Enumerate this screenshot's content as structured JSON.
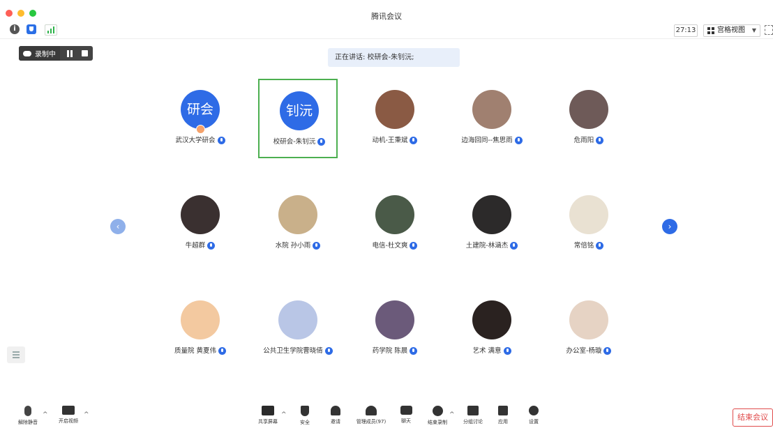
{
  "window": {
    "title": "腾讯会议"
  },
  "topbar": {
    "timer": "27:13",
    "view_mode": "宫格视图"
  },
  "recording": {
    "status": "录制中"
  },
  "speaking_banner": "正在讲话: 校研会-朱钊沅;",
  "participants": [
    {
      "name": "武汉大学研会",
      "avatar_text": "研会",
      "avatar_color": "#2e6be6",
      "host": true
    },
    {
      "name": "校研会-朱钊沅",
      "avatar_text": "钊沅",
      "avatar_color": "#2e6be6",
      "speaking": true
    },
    {
      "name": "动机-王秉斌",
      "avatar_color": "#8a5a44"
    },
    {
      "name": "边海回同--焦思雨",
      "avatar_color": "#a08070"
    },
    {
      "name": "危雨阳",
      "avatar_color": "#6e5a58"
    },
    {
      "name": "牛超群",
      "avatar_color": "#3a3030"
    },
    {
      "name": "水院 孙小雨",
      "avatar_color": "#c9b08a"
    },
    {
      "name": "电信-杜文爽",
      "avatar_color": "#4a5a48"
    },
    {
      "name": "土建院-林涵杰",
      "avatar_color": "#2c2a2a"
    },
    {
      "name": "常倍铭",
      "avatar_color": "#e9e1d2"
    },
    {
      "name": "质量院 黄夏伟",
      "avatar_color": "#f3c9a0"
    },
    {
      "name": "公共卫生学院曹晓倩",
      "avatar_color": "#b9c6e6"
    },
    {
      "name": "药学院 陈晨",
      "avatar_color": "#6b5a7a"
    },
    {
      "name": "艺术 满意",
      "avatar_color": "#2a2220"
    },
    {
      "name": "办公室-杨璇",
      "avatar_color": "#e6d3c4"
    }
  ],
  "toolbar": {
    "unmute": "解除静音",
    "start_video": "开启视频",
    "share_screen": "共享屏幕",
    "security": "安全",
    "invite": "邀请",
    "manage_members": "管理成员(97)",
    "chat": "聊天",
    "end_recording": "结束录制",
    "breakout": "分组讨论",
    "apps": "应用",
    "settings": "设置",
    "end_meeting": "结束会议"
  },
  "colors": {
    "accent": "#2e6be6",
    "active_border": "#4caf50",
    "end_red": "#e04a4a"
  }
}
